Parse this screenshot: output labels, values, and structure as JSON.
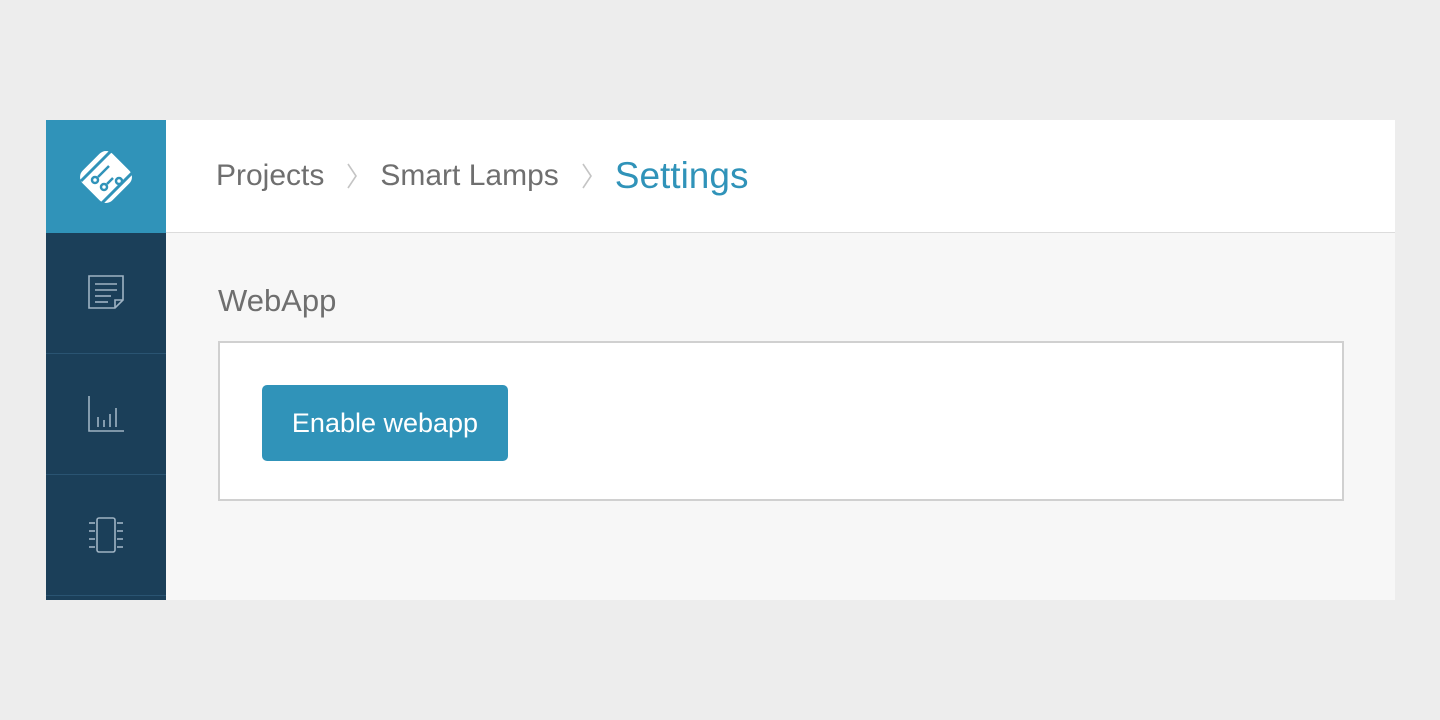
{
  "sidebar": {
    "logo_icon": "diamond-circuit-logo-icon",
    "items": [
      {
        "icon": "document-icon"
      },
      {
        "icon": "bar-chart-icon"
      },
      {
        "icon": "chip-icon"
      }
    ]
  },
  "breadcrumb": {
    "items": [
      "Projects",
      "Smart Lamps"
    ],
    "current": "Settings"
  },
  "section": {
    "title": "WebApp",
    "button_label": "Enable webapp"
  },
  "colors": {
    "accent": "#3093b9",
    "sidebar": "#1b3f59",
    "background": "#ededed"
  }
}
